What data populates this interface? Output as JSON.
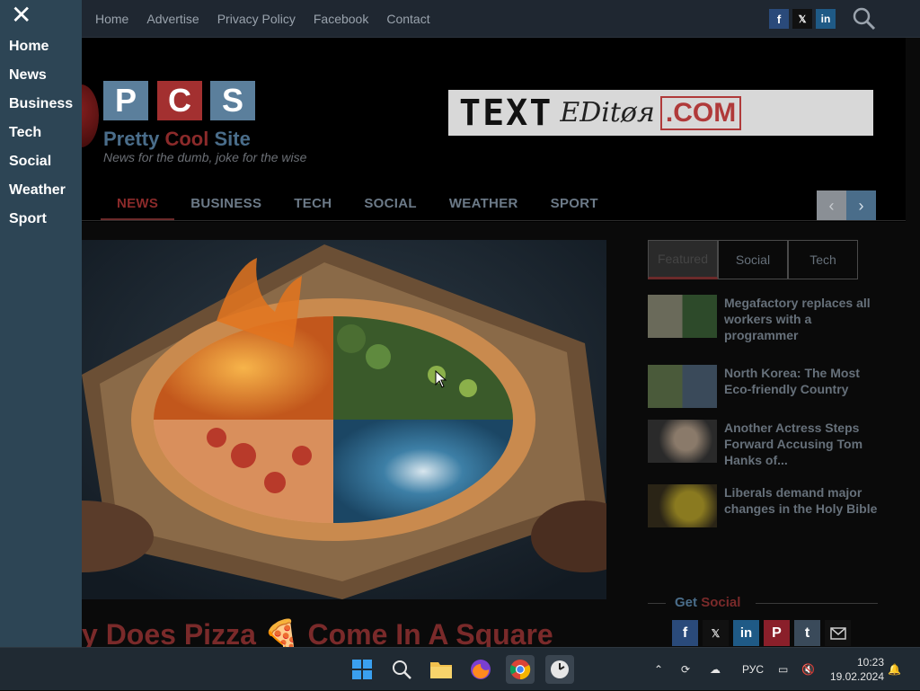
{
  "sidebar_menu": {
    "items": [
      "Home",
      "News",
      "Business",
      "Tech",
      "Social",
      "Weather",
      "Sport"
    ]
  },
  "topbar": {
    "links": [
      "Home",
      "Advertise",
      "Privacy Policy",
      "Facebook",
      "Contact"
    ],
    "social": [
      "f",
      "𝕏",
      "in"
    ]
  },
  "header": {
    "logo_letters": [
      "P",
      "C",
      "S"
    ],
    "site_title_1": "Pretty ",
    "site_title_2": "Cool",
    "site_title_3": " Site",
    "tagline": "News for the dumb, joke for the wise",
    "banner_1": "TEXT",
    "banner_2": "EDitøя",
    "banner_3": ".COM"
  },
  "nav": {
    "items": [
      "NEWS",
      "BUSINESS",
      "TECH",
      "SOCIAL",
      "WEATHER",
      "SPORT"
    ],
    "active": "NEWS",
    "prev": "‹",
    "next": "›"
  },
  "main": {
    "headline": "y Does Pizza 🍕 Come In A Square"
  },
  "side": {
    "tabs": [
      "Featured",
      "Social",
      "Tech"
    ],
    "active_tab": "Featured",
    "news": [
      "Megafactory replaces all workers with a programmer",
      "North Korea: The Most Eco-friendly Country",
      "Another Actress Steps Forward Accusing Tom Hanks of...",
      "Liberals demand major changes in the Holy Bible"
    ],
    "get_social_1": "Get ",
    "get_social_2": "Social"
  },
  "taskbar": {
    "lang": "РУС",
    "time": "10:23",
    "date": "19.02.2024"
  },
  "colors": {
    "accent_red": "#8b2a2a",
    "accent_blue": "#4a6d8a",
    "side_menu_bg": "#2d4555"
  }
}
